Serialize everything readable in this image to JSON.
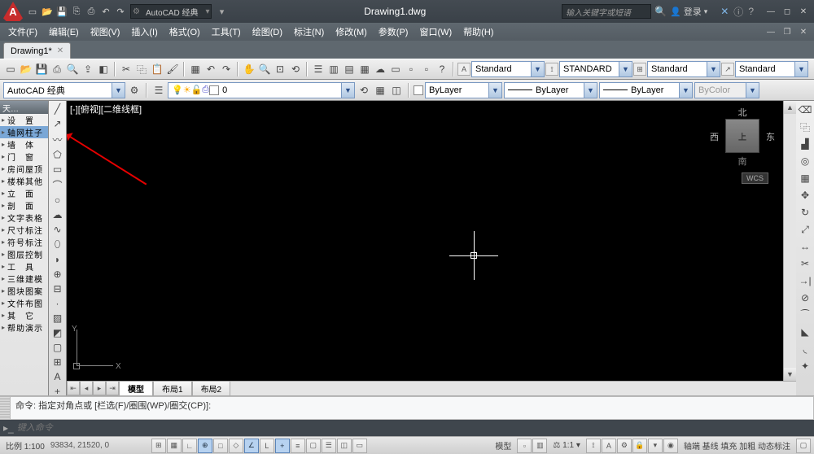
{
  "title": "Drawing1.dwg",
  "workspace_selector": "AutoCAD 经典",
  "search_placeholder": "输入关键字或短语",
  "login": "登录",
  "menus": [
    "文件(F)",
    "编辑(E)",
    "视图(V)",
    "插入(I)",
    "格式(O)",
    "工具(T)",
    "绘图(D)",
    "标注(N)",
    "修改(M)",
    "参数(P)",
    "窗口(W)",
    "帮助(H)"
  ],
  "doc_tab": "Drawing1*",
  "layer_combo": "AutoCAD 经典",
  "layer_state": "0",
  "layer_name": "ByLayer",
  "linetype": "ByLayer",
  "lineweight": "ByLayer",
  "plotstyle": "ByColor",
  "styles": {
    "text": "Standard",
    "dim": "STANDARD",
    "table": "Standard",
    "ml": "Standard"
  },
  "left_panel_header": "天…",
  "left_items": [
    "设　置",
    "轴网柱子",
    "墙　体",
    "门　窗",
    "房间屋顶",
    "楼梯其他",
    "立　面",
    "剖　面",
    "文字表格",
    "尺寸标注",
    "符号标注",
    "图层控制",
    "工　具",
    "三维建模",
    "图块图案",
    "文件布图",
    "其　它",
    "帮助演示"
  ],
  "canvas_label": "[-][俯视][二维线框]",
  "viewcube": {
    "top": "上",
    "n": "北",
    "s": "南",
    "e": "东",
    "w": "西",
    "wcs": "WCS"
  },
  "ucs": {
    "x": "X",
    "y": "Y"
  },
  "model_tabs": [
    "模型",
    "布局1",
    "布局2"
  ],
  "cmd_history": "命令: 指定对角点或 [栏选(F)/圈围(WP)/圈交(CP)]:",
  "cmd_placeholder": "键入命令",
  "scale_label": "比例 1:100",
  "coords": "93834, 21520, 0",
  "status_right_text": [
    "模型",
    "1:1",
    "轴端 基线 填充 加粗 动态标注"
  ]
}
